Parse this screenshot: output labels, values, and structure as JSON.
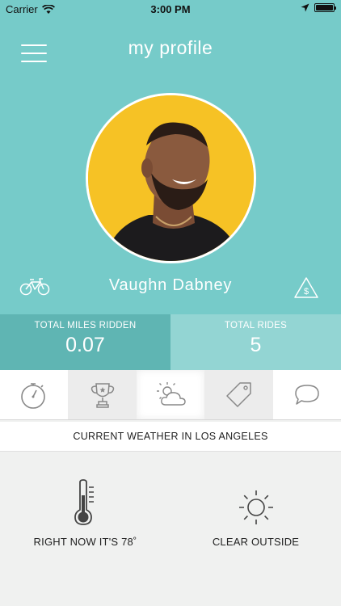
{
  "status_bar": {
    "carrier": "Carrier",
    "time": "3:00 PM"
  },
  "header": {
    "title": "my profile"
  },
  "profile": {
    "name": "Vaughn Dabney"
  },
  "stats": {
    "miles_label": "TOTAL MILES RIDDEN",
    "miles_value": "0.07",
    "rides_label": "TOTAL RIDES",
    "rides_value": "5"
  },
  "tabs": [
    {
      "icon": "stopwatch-icon"
    },
    {
      "icon": "trophy-icon"
    },
    {
      "icon": "weather-icon",
      "active": true
    },
    {
      "icon": "tag-icon"
    },
    {
      "icon": "chat-icon"
    }
  ],
  "weather": {
    "header": "CURRENT WEATHER IN LOS ANGELES",
    "temperature_text": "RIGHT NOW IT'S 78˚",
    "condition_text": "CLEAR OUTSIDE"
  },
  "colors": {
    "teal": "#76cbc9",
    "teal_dark": "#5fb5b3",
    "teal_light": "#93d5d3",
    "avatar_bg": "#f6c225"
  }
}
